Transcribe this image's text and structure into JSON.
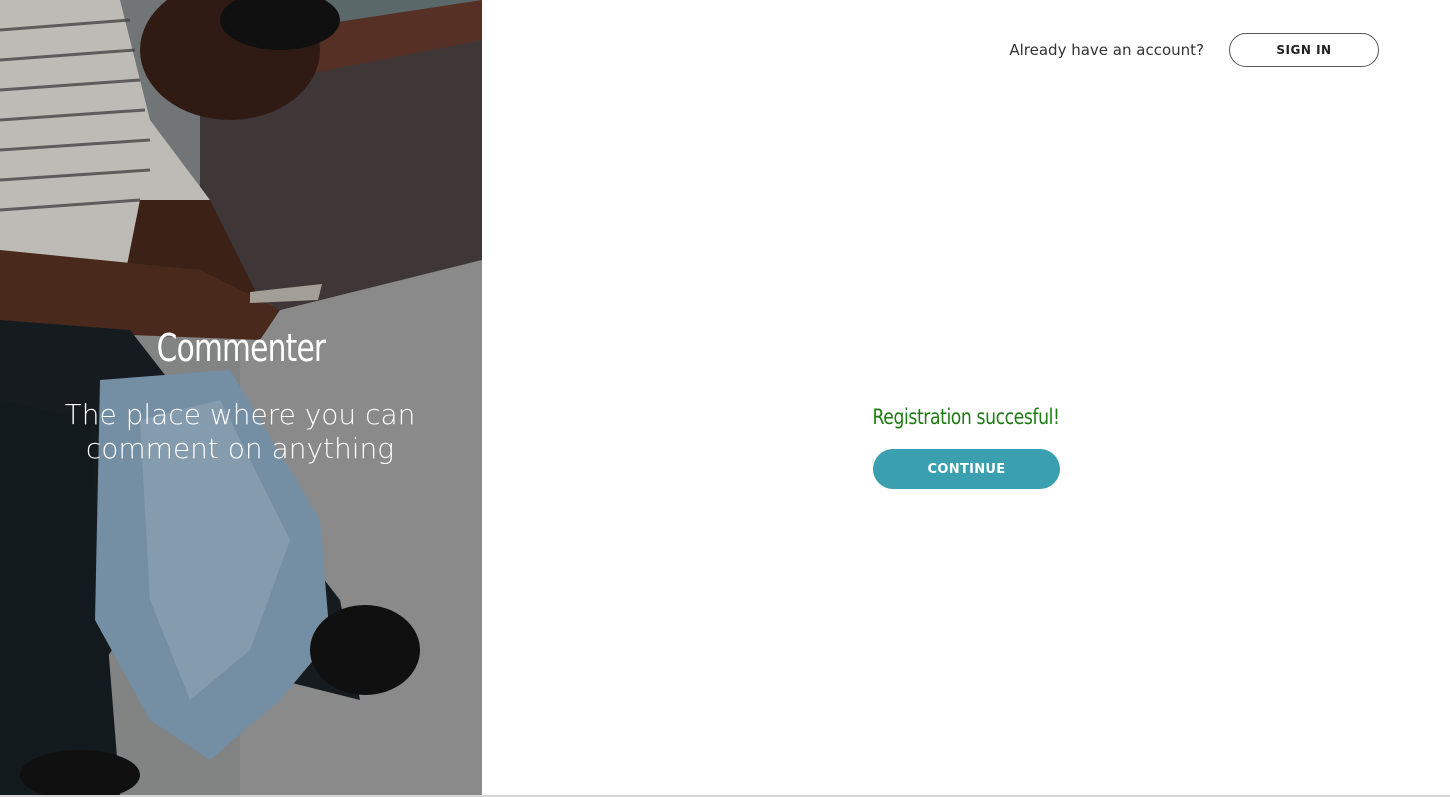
{
  "hero": {
    "brand_title": "Commenter",
    "tagline": "The place where you can comment on anything"
  },
  "header": {
    "prompt_text": "Already have an account?",
    "sign_in_label": "SIGN IN"
  },
  "main": {
    "status_message": "Registration succesful!",
    "continue_label": "CONTINUE"
  },
  "colors": {
    "accent": "#3a9fae",
    "success": "#1e7a12"
  }
}
